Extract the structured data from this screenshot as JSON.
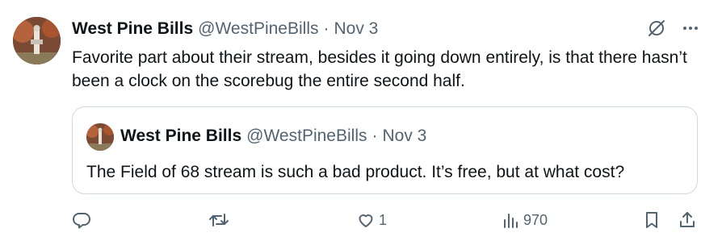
{
  "tweet": {
    "author_name": "West Pine Bills",
    "author_handle": "@WestPineBills",
    "separator": "·",
    "date": "Nov 3",
    "text": "Favorite part about their stream, besides it going down entirely, is that there hasn’t been a clock on the scorebug the entire second half."
  },
  "quote": {
    "author_name": "West Pine Bills",
    "author_handle": "@WestPineBills",
    "separator": "·",
    "date": "Nov 3",
    "text": "The Field of 68 stream is such a bad product. It’s free, but at what cost?"
  },
  "actions": {
    "reply_count": "",
    "retweet_count": "",
    "like_count": "1",
    "views_count": "970"
  },
  "icons": {
    "grok": "grok-icon",
    "more": "more-icon",
    "reply": "reply-icon",
    "retweet": "retweet-icon",
    "like": "like-icon",
    "views": "views-icon",
    "bookmark": "bookmark-icon",
    "share": "share-icon"
  },
  "colors": {
    "text": "#0f1419",
    "secondary": "#536471",
    "border": "#cfd9de"
  }
}
